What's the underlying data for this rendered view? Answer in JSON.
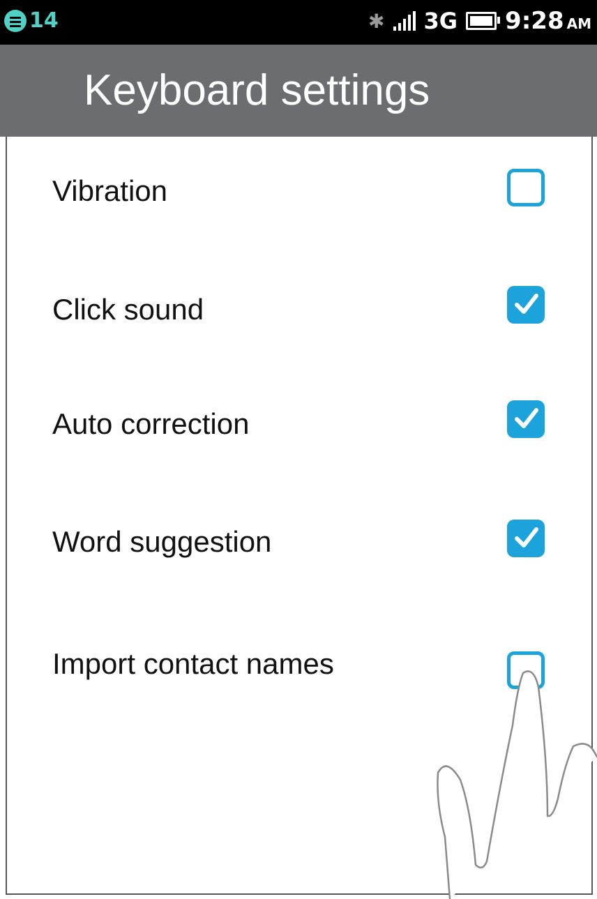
{
  "status_bar": {
    "notification_count": "14",
    "network_type": "3G",
    "time": "9:28",
    "ampm": "AM",
    "icons": [
      "notification-icon",
      "bluetooth-icon",
      "signal-icon",
      "battery-icon"
    ]
  },
  "header": {
    "title": "Keyboard settings",
    "background_color": "#6b6d70"
  },
  "settings": [
    {
      "label": "Vibration",
      "checked": false
    },
    {
      "label": "Click sound",
      "checked": true
    },
    {
      "label": "Auto correction",
      "checked": true
    },
    {
      "label": "Word suggestion",
      "checked": true
    },
    {
      "label": "Import contact names",
      "checked": false
    }
  ],
  "accent_color": "#1ca3dc"
}
